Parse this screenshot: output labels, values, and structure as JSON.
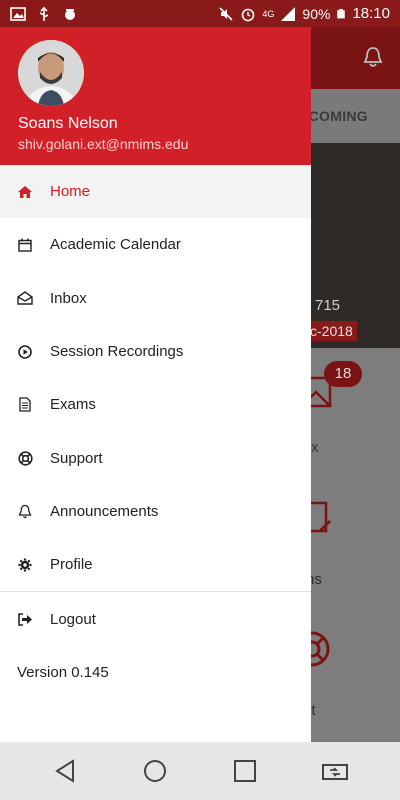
{
  "status_bar": {
    "battery": "90%",
    "time": "18:10",
    "network": "4G"
  },
  "background": {
    "tab_label": "PCOMING",
    "banner_number": "715",
    "banner_date": "c-2018",
    "badge_count": "18",
    "label_1": "x",
    "label_2": "ns",
    "label_3": "ort"
  },
  "drawer": {
    "user": {
      "name": "Soans Nelson",
      "email": "shiv.golani.ext@nmims.edu"
    },
    "items": [
      {
        "label": "Home",
        "icon": "home-icon",
        "active": true
      },
      {
        "label": "Academic Calendar",
        "icon": "calendar-icon"
      },
      {
        "label": "Inbox",
        "icon": "inbox-icon"
      },
      {
        "label": "Session Recordings",
        "icon": "play-circle-icon"
      },
      {
        "label": "Exams",
        "icon": "document-icon"
      },
      {
        "label": "Support",
        "icon": "lifebuoy-icon"
      },
      {
        "label": "Announcements",
        "icon": "bell-icon"
      },
      {
        "label": "Profile",
        "icon": "gear-icon"
      }
    ],
    "logout_label": "Logout",
    "version": "Version 0.145"
  },
  "colors": {
    "accent": "#d12027",
    "status_bar": "#8a1919"
  }
}
